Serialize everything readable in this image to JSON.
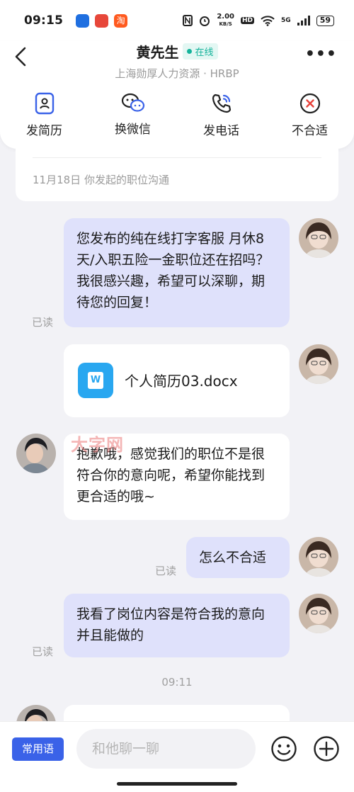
{
  "status_bar": {
    "time": "09:15",
    "net_speed_value": "2.00",
    "net_speed_unit": "KB/S",
    "hd": "HD",
    "signal": "5G",
    "battery": "59",
    "app_icons": [
      "app-blue-icon",
      "app-red-icon",
      "taobao-icon"
    ],
    "taobao_glyph": "淘"
  },
  "header": {
    "contact_name": "黄先生",
    "online_status": "在线",
    "company": "上海勋厚人力资源 · HRBP",
    "back_glyph": "‹",
    "more_glyph": "•••"
  },
  "actions": [
    {
      "label": "发简历",
      "icon": "resume-icon"
    },
    {
      "label": "换微信",
      "icon": "wechat-icon"
    },
    {
      "label": "发电话",
      "icon": "phone-icon"
    },
    {
      "label": "不合适",
      "icon": "reject-icon"
    }
  ],
  "chat": {
    "notice": "11月18日 你发起的职位沟通",
    "messages": [
      {
        "from": "me",
        "text": "您发布的纯在线打字客服 月休8天/入职五险一金职位还在招吗？我很感兴趣，希望可以深聊，期待您的回复！",
        "status": "已读"
      },
      {
        "from": "me",
        "type": "file",
        "file_name": "个人简历03.docx",
        "file_icon_letter": "W"
      },
      {
        "from": "them",
        "text": "抱歉哦，感觉我们的职位不是很符合你的意向呢，希望你能找到更合适的哦~"
      },
      {
        "from": "me",
        "text": "怎么不合适",
        "status": "已读"
      },
      {
        "from": "me",
        "text": "我看了岗位内容是符合我的意向并且能做的",
        "status": "已读"
      }
    ],
    "time_divider": "09:11",
    "watermark": "大字网"
  },
  "input_bar": {
    "phrases_label": "常用语",
    "placeholder": "和他聊一聊"
  },
  "colors": {
    "accent": "#3a62e8",
    "my_bubble": "#dfe1fb",
    "online_green": "#14b39b",
    "reject_red": "#e8423a"
  }
}
